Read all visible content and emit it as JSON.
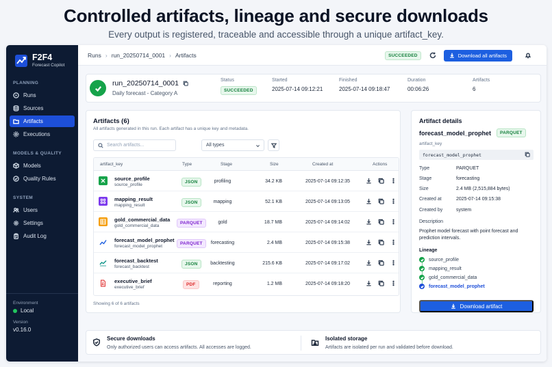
{
  "hero": {
    "title": "Controlled artifacts, lineage and secure downloads",
    "subtitle": "Every output is registered, traceable and accessible through a unique artifact_key."
  },
  "brand": {
    "name": "F2F4",
    "tagline": "Forecast Copilot"
  },
  "sidebar": {
    "sections": [
      {
        "label": "PLANNING",
        "items": [
          {
            "label": "Runs",
            "icon": "play-circle-icon"
          },
          {
            "label": "Sources",
            "icon": "database-icon"
          },
          {
            "label": "Artifacts",
            "icon": "folder-icon",
            "active": true
          },
          {
            "label": "Executions",
            "icon": "cog-icon"
          }
        ]
      },
      {
        "label": "MODELS & QUALITY",
        "items": [
          {
            "label": "Models",
            "icon": "cube-icon"
          },
          {
            "label": "Quality Rules",
            "icon": "check-badge-icon"
          }
        ]
      },
      {
        "label": "SYSTEM",
        "items": [
          {
            "label": "Users",
            "icon": "users-icon"
          },
          {
            "label": "Settings",
            "icon": "gear-icon"
          },
          {
            "label": "Audit Log",
            "icon": "clipboard-icon"
          }
        ]
      }
    ],
    "environment_label": "Environment",
    "environment_value": "Local",
    "version_label": "Version",
    "version_value": "v0.16.0"
  },
  "topbar": {
    "breadcrumb": [
      "Runs",
      "run_20250714_0001",
      "Artifacts"
    ],
    "status": "SUCCEEDED",
    "download_all": "Download all artifacts"
  },
  "summary": {
    "run_id": "run_20250714_0001",
    "description": "Daily forecast - Category A",
    "status_label": "Status",
    "status_value": "SUCCEEDED",
    "started_label": "Started",
    "started_value": "2025-07-14 09:12:21",
    "finished_label": "Finished",
    "finished_value": "2025-07-14 09:18:47",
    "duration_label": "Duration",
    "duration_value": "00:06:26",
    "artifacts_label": "Artifacts",
    "artifacts_value": "6"
  },
  "artifacts": {
    "title": "Artifacts (6)",
    "description": "All artifacts generated in this run. Each artifact has a unique key and metadata.",
    "search_placeholder": "Search artifacts...",
    "type_filter": "All types",
    "columns": [
      "artifact_key",
      "Type",
      "Stage",
      "Size",
      "Created at",
      "Actions"
    ],
    "rows": [
      {
        "name": "source_profile",
        "key": "source_profile",
        "type": "JSON",
        "stage": "profiling",
        "size": "34.2 KB",
        "created": "2025-07-14 09:12:35",
        "icon": "spreadsheet-icon"
      },
      {
        "name": "mapping_result",
        "key": "mapping_result",
        "type": "JSON",
        "stage": "mapping",
        "size": "52.1 KB",
        "created": "2025-07-14 09:13:05",
        "icon": "mapping-icon"
      },
      {
        "name": "gold_commercial_data",
        "key": "gold_commercial_data",
        "type": "PARQUET",
        "stage": "gold",
        "size": "18.7 MB",
        "created": "2025-07-14 09:14:02",
        "icon": "table-icon"
      },
      {
        "name": "forecast_model_prophet",
        "key": "forecast_model_prophet",
        "type": "PARQUET",
        "stage": "forecasting",
        "size": "2.4 MB",
        "created": "2025-07-14 09:15:38",
        "icon": "line-chart-icon"
      },
      {
        "name": "forecast_backtest",
        "key": "forecast_backtest",
        "type": "JSON",
        "stage": "backtesting",
        "size": "215.6 KB",
        "created": "2025-07-14 09:17:02",
        "icon": "line-chart-icon"
      },
      {
        "name": "executive_brief",
        "key": "executive_brief",
        "type": "PDF",
        "stage": "reporting",
        "size": "1.2 MB",
        "created": "2025-07-14 09:18:20",
        "icon": "pdf-icon"
      }
    ],
    "footer": "Showing 6 of 6 artifacts"
  },
  "details": {
    "title": "Artifact details",
    "name": "forecast_model_prophet",
    "type_badge": "PARQUET",
    "key_label": "artifact_key",
    "key_value": "forecast_model_prophet",
    "fields": [
      {
        "label": "Type",
        "value": "PARQUET"
      },
      {
        "label": "Stage",
        "value": "forecasting"
      },
      {
        "label": "Size",
        "value": "2.4 MB (2,515,884 bytes)"
      },
      {
        "label": "Created at",
        "value": "2025-07-14 09:15:38"
      },
      {
        "label": "Created by",
        "value": "system"
      }
    ],
    "description_label": "Description",
    "description_value": "Prophet model forecast with point forecast and prediction intervals.",
    "lineage_label": "Lineage",
    "lineage": [
      "source_profile",
      "mapping_result",
      "gold_commercial_data",
      "forecast_model_prophet"
    ],
    "download": "Download artifact"
  },
  "footer": {
    "secure_title": "Secure downloads",
    "secure_text": "Only authorized users can access artifacts. All accesses are logged.",
    "storage_title": "Isolated storage",
    "storage_text": "Artifacts are isolated per run and validated before download."
  },
  "colors": {
    "sidebar": "#0d1b33",
    "accent": "#1d5fe0",
    "success": "#16a34a"
  }
}
